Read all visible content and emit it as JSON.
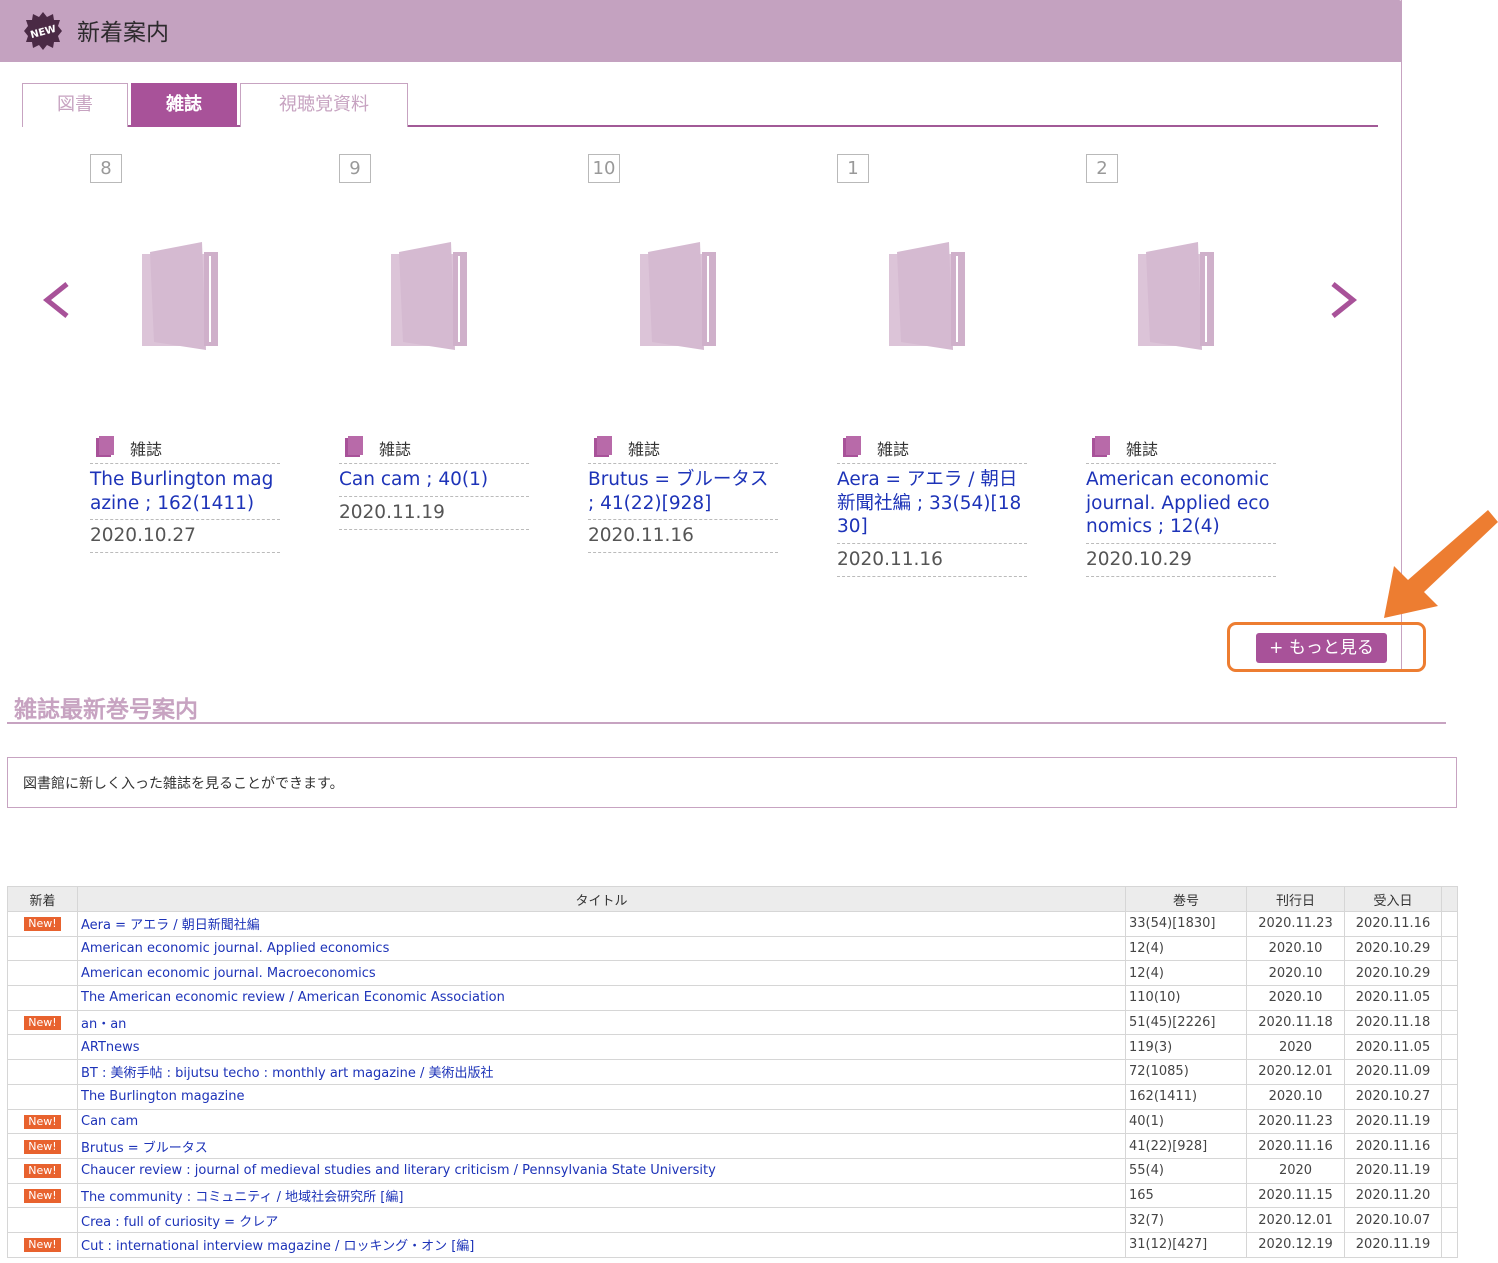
{
  "panel": {
    "title": "新着案内",
    "badge_icon": "new-badge-icon"
  },
  "tabs": [
    {
      "label": "図書",
      "active": false
    },
    {
      "label": "雑誌",
      "active": true
    },
    {
      "label": "視聴覚資料",
      "active": false
    }
  ],
  "carousel": {
    "prev_icon": "chevron-left-icon",
    "next_icon": "chevron-right-icon",
    "items": [
      {
        "rank": "8",
        "type": "雑誌",
        "title": "The Burlington magazine ; 162(1411)",
        "date": "2020.10.27"
      },
      {
        "rank": "9",
        "type": "雑誌",
        "title": "Can cam ; 40(1)",
        "date": "2020.11.19"
      },
      {
        "rank": "10",
        "type": "雑誌",
        "title": "Brutus = ブルータス ; 41(22)[928]",
        "date": "2020.11.16"
      },
      {
        "rank": "1",
        "type": "雑誌",
        "title": "Aera = アエラ / 朝日新聞社編 ; 33(54)[1830]",
        "date": "2020.11.16"
      },
      {
        "rank": "2",
        "type": "雑誌",
        "title": "American economic journal. Applied economics ; 12(4)",
        "date": "2020.10.29"
      }
    ]
  },
  "more_button": {
    "label": "+ もっと見る"
  },
  "section": {
    "title": "雑誌最新巻号案内",
    "description": "図書館に新しく入った雑誌を見ることができます。"
  },
  "table": {
    "headers": [
      "新着",
      "タイトル",
      "巻号",
      "刊行日",
      "受入日"
    ],
    "new_label": "New!",
    "rows": [
      {
        "new": true,
        "title": "Aera = アエラ / 朝日新聞社編",
        "vol": "33(54)[1830]",
        "pub": "2020.11.23",
        "recv": "2020.11.16"
      },
      {
        "new": false,
        "title": "American economic journal. Applied economics",
        "vol": "12(4)",
        "pub": "2020.10",
        "recv": "2020.10.29"
      },
      {
        "new": false,
        "title": "American economic journal. Macroeconomics",
        "vol": "12(4)",
        "pub": "2020.10",
        "recv": "2020.10.29"
      },
      {
        "new": false,
        "title": "The American economic review / American Economic Association",
        "vol": "110(10)",
        "pub": "2020.10",
        "recv": "2020.11.05"
      },
      {
        "new": true,
        "title": "an・an",
        "vol": "51(45)[2226]",
        "pub": "2020.11.18",
        "recv": "2020.11.18"
      },
      {
        "new": false,
        "title": "ARTnews",
        "vol": "119(3)",
        "pub": "2020",
        "recv": "2020.11.05"
      },
      {
        "new": false,
        "title": "BT : 美術手帖 : bijutsu techo : monthly art magazine / 美術出版社",
        "vol": "72(1085)",
        "pub": "2020.12.01",
        "recv": "2020.11.09"
      },
      {
        "new": false,
        "title": "The Burlington magazine",
        "vol": "162(1411)",
        "pub": "2020.10",
        "recv": "2020.10.27"
      },
      {
        "new": true,
        "title": "Can cam",
        "vol": "40(1)",
        "pub": "2020.11.23",
        "recv": "2020.11.19"
      },
      {
        "new": true,
        "title": "Brutus = ブルータス",
        "vol": "41(22)[928]",
        "pub": "2020.11.16",
        "recv": "2020.11.16"
      },
      {
        "new": true,
        "title": "Chaucer review : journal of medieval studies and literary criticism / Pennsylvania State University",
        "vol": "55(4)",
        "pub": "2020",
        "recv": "2020.11.19"
      },
      {
        "new": true,
        "title": "The community : コミュニティ / 地域社会研究所 [編]",
        "vol": "165",
        "pub": "2020.11.15",
        "recv": "2020.11.20"
      },
      {
        "new": false,
        "title": "Crea : full of curiosity = クレア",
        "vol": "32(7)",
        "pub": "2020.12.01",
        "recv": "2020.10.07"
      },
      {
        "new": true,
        "title": "Cut : international interview magazine / ロッキング・オン [編]",
        "vol": "31(12)[427]",
        "pub": "2020.12.19",
        "recv": "2020.11.19"
      }
    ]
  },
  "colors": {
    "accent": "#a85299",
    "header_bg": "#c4a2c0",
    "light_accent": "#c7a3c1",
    "callout": "#ed7d31",
    "new_tag": "#e8622e",
    "link": "#1d33b8"
  }
}
